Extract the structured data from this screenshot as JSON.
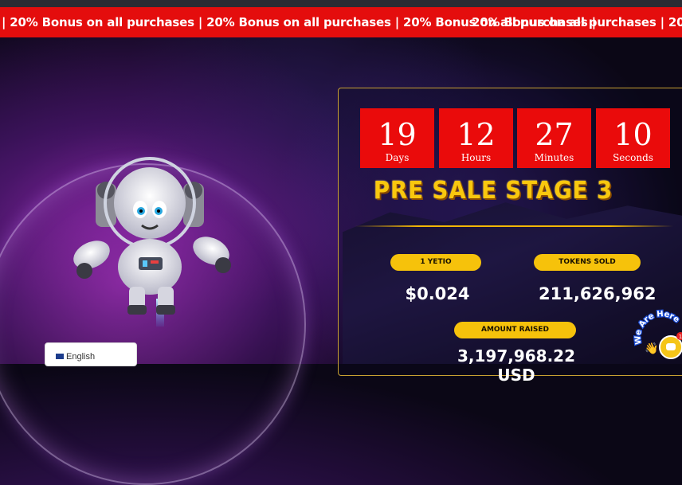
{
  "ticker": {
    "text_left": "| 20% Bonus on all purchases | 20% Bonus on all purchases | 20% Bonus on all purchases |",
    "text_right": "20% Bonus on all purchases | 20% Bonus o"
  },
  "countdown": [
    {
      "value": "19",
      "label": "Days"
    },
    {
      "value": "12",
      "label": "Hours"
    },
    {
      "value": "27",
      "label": "Minutes"
    },
    {
      "value": "10",
      "label": "Seconds"
    }
  ],
  "presale": {
    "title": "PRE SALE STAGE 3",
    "price_label": "1 YETIO",
    "price_value": "$0.024",
    "tokens_label": "TOKENS SOLD",
    "tokens_value": "211,626,962",
    "raised_label": "AMOUNT RAISED",
    "raised_value": "3,197,968.22 USD"
  },
  "language": {
    "current": "English"
  },
  "chat": {
    "label": "We Are Here",
    "badge_count": "1"
  },
  "colors": {
    "ticker": "#e40d0d",
    "countdown": "#ea0b0b",
    "accent": "#f6c20b"
  }
}
